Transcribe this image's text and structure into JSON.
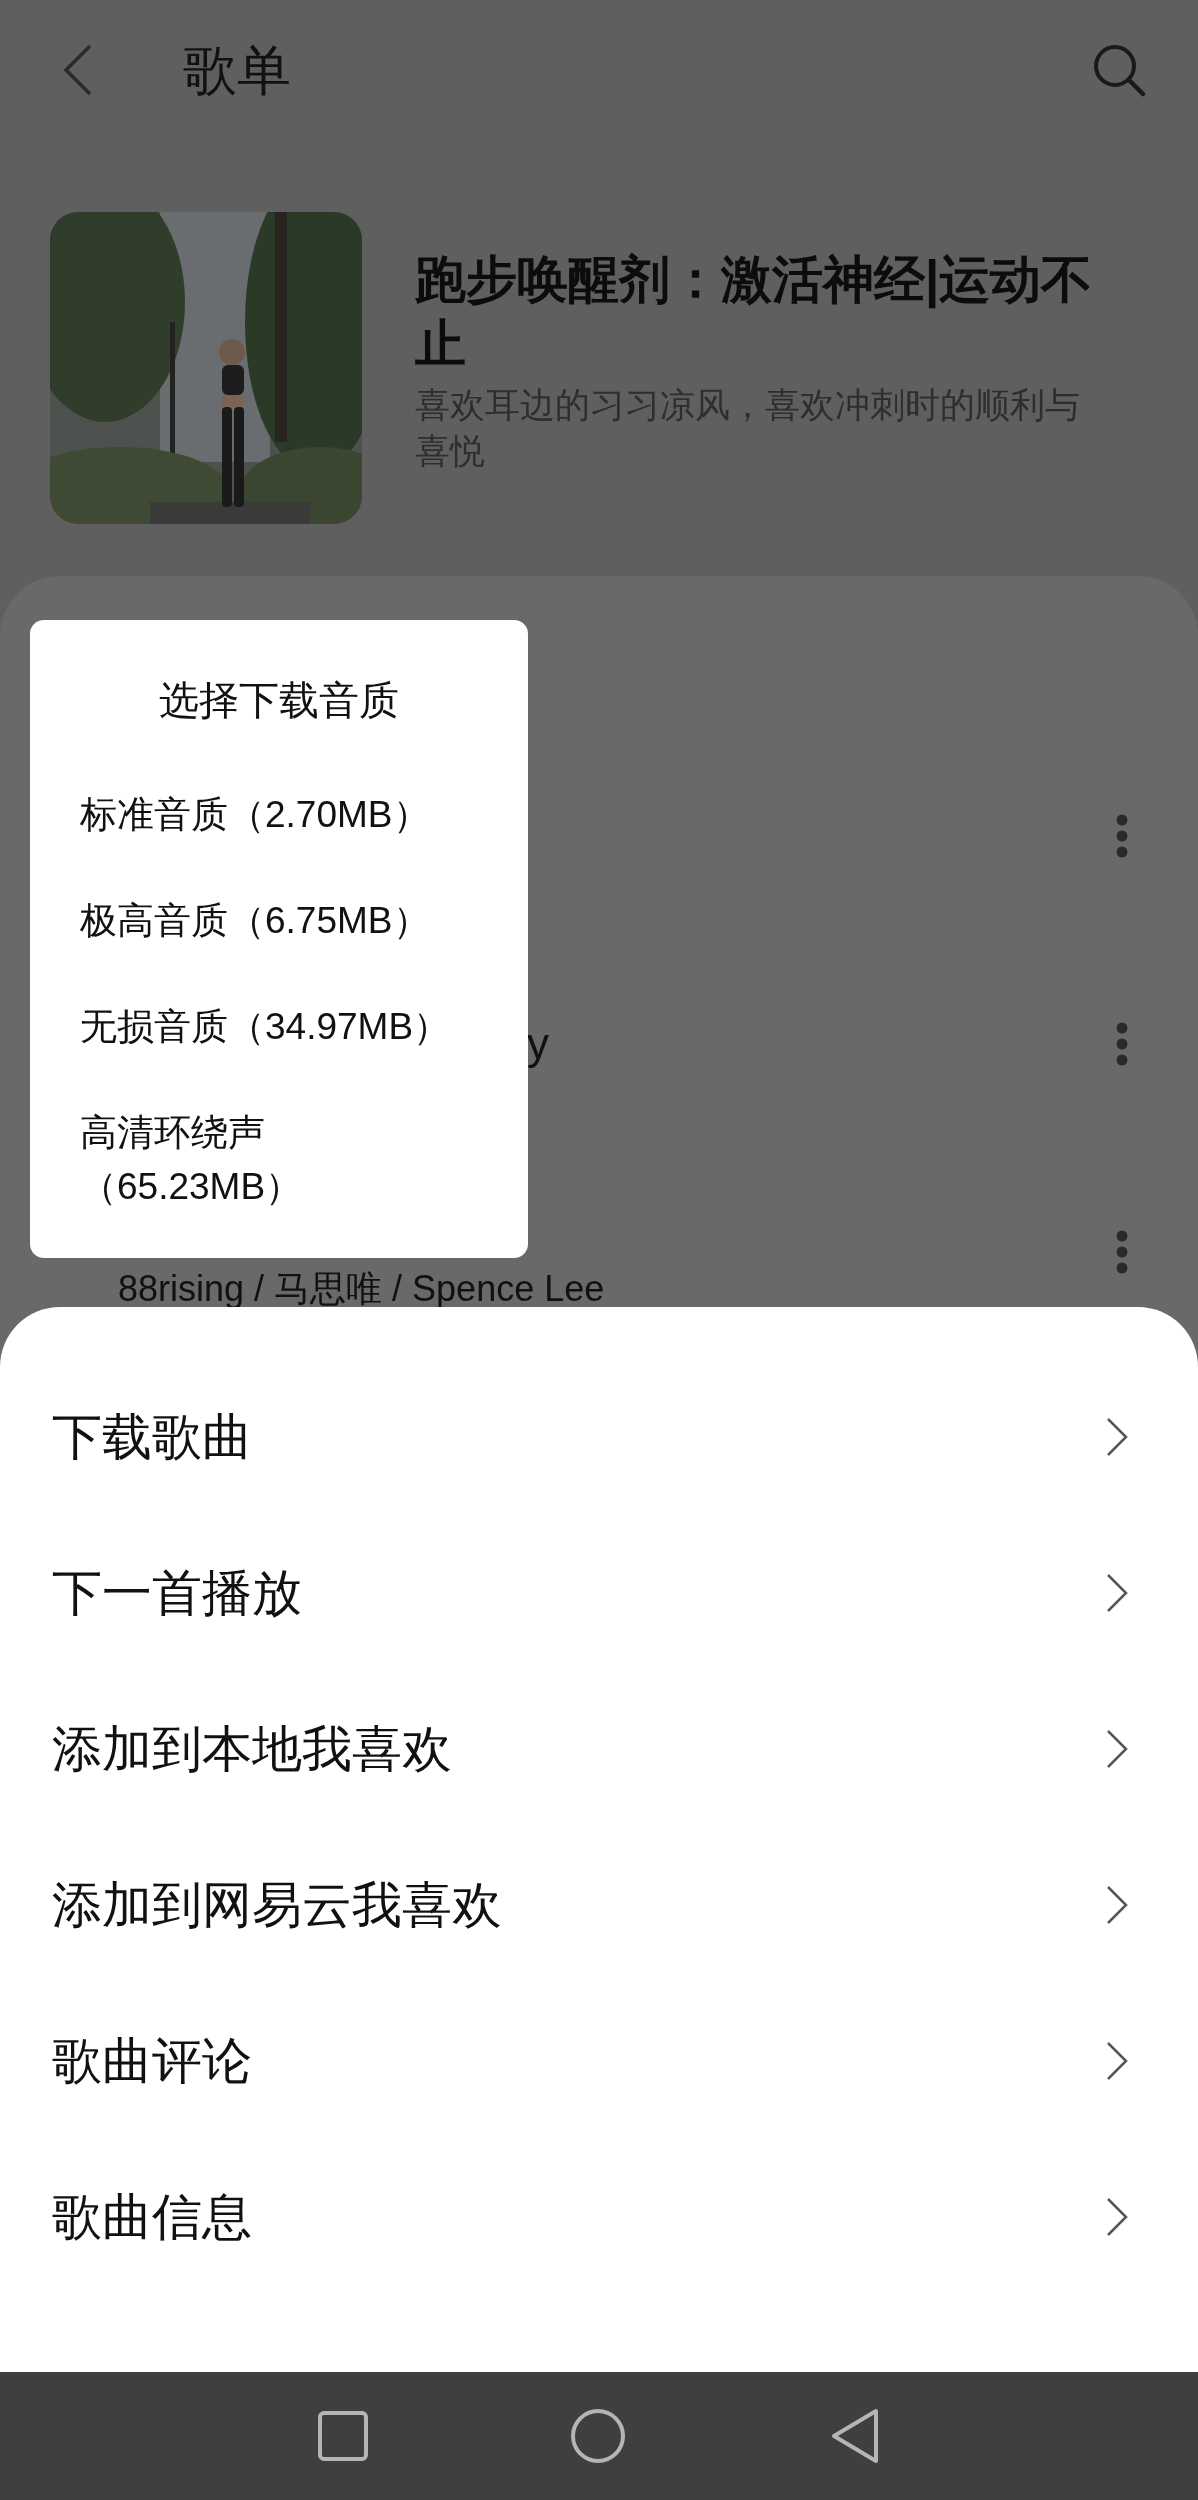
{
  "header": {
    "title": "歌单"
  },
  "playlist": {
    "title": "跑步唤醒剂：激活神经|运动不止",
    "description": "喜欢耳边的习习凉风，喜欢冲刺时的顺利与喜悦"
  },
  "songs": [
    {
      "kind": "hidden"
    },
    {
      "kind": "cut_title",
      "title": "y"
    },
    {
      "kind": "partial",
      "artist": "88rising / 马思唯 / Spence Lee"
    }
  ],
  "quality_popup": {
    "title": "选择下载音质",
    "options": [
      "标准音质（2.70MB）",
      "极高音质（6.75MB）",
      "无损音质（34.97MB）",
      "高清环绕声（65.23MB）"
    ]
  },
  "action_sheet": {
    "items": [
      "下载歌曲",
      "下一首播放",
      "添加到本地我喜欢",
      "添加到网易云我喜欢",
      "歌曲评论",
      "歌曲信息"
    ]
  }
}
